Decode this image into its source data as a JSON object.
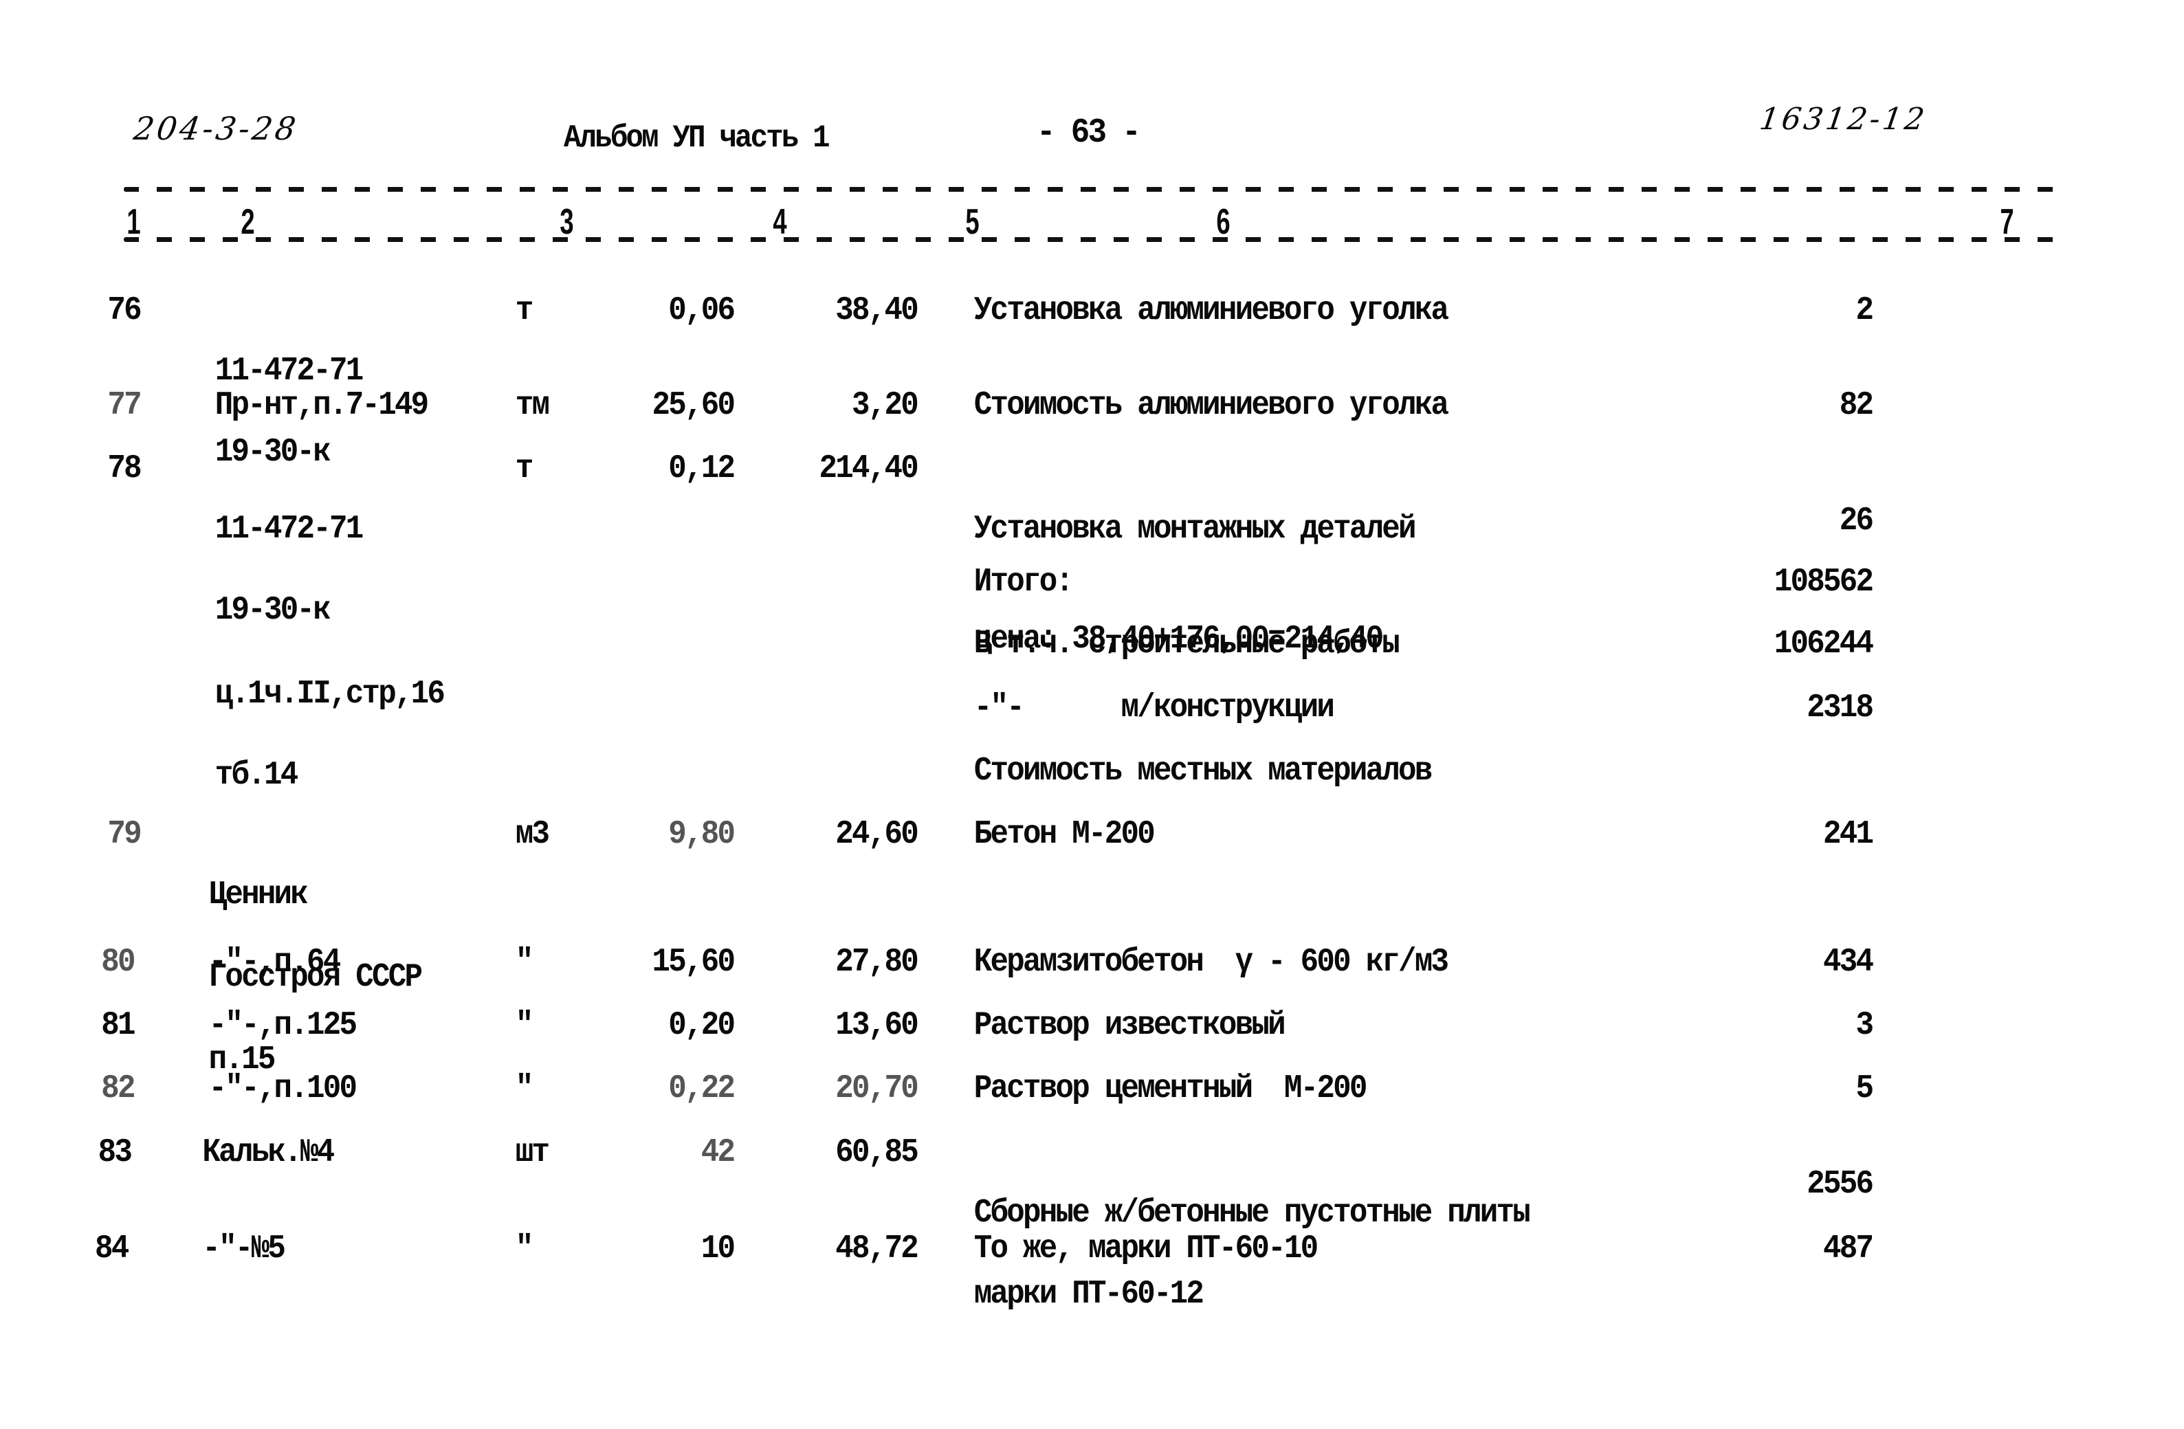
{
  "header": {
    "doc_code_handwritten": "204-3-28",
    "album_title": "Альбом УП часть 1",
    "page_number": "- 63 -",
    "archive_number_handwritten": "16312-12"
  },
  "columns": [
    "1",
    "2",
    "3",
    "4",
    "5",
    "6",
    "7"
  ],
  "rows": [
    {
      "no": "76",
      "ref": [
        "11-472-71",
        "19-30-к"
      ],
      "unit": "т",
      "quantity": "0,06",
      "price": "38,40",
      "description": [
        "Установка алюминиевого уголка"
      ],
      "cost": "2"
    },
    {
      "no": "77",
      "ref": [
        "Пр-нт,п.7-149"
      ],
      "unit": "тм",
      "quantity": "25,60",
      "price": "3,20",
      "description": [
        "Стоимость алюминиевого уголка"
      ],
      "cost": "82"
    },
    {
      "no": "78",
      "ref": [
        "11-472-71",
        "19-30-к",
        "ц.1ч.II,стр,16",
        "тб.14"
      ],
      "unit": "т",
      "quantity": "0,12",
      "price": "214,40",
      "description": [
        "Установка монтажных деталей",
        "цена: 38,40+176,00=214,40"
      ],
      "cost": "26"
    }
  ],
  "summary": [
    {
      "label": "Итого:",
      "value": "108562"
    },
    {
      "label": "В т.ч. строительные работы",
      "value": "106244"
    },
    {
      "label": "-\"-      м/конструкции",
      "value": "2318"
    },
    {
      "label": "Стоимость местных материалов",
      "value": ""
    }
  ],
  "rows_local": [
    {
      "no": "79",
      "ref": [
        "Ценник",
        "Госстроя СССР",
        "п.15"
      ],
      "unit": "м3",
      "quantity": "9,80",
      "price": "24,60",
      "description": [
        "Бетон М-200"
      ],
      "cost": "241"
    },
    {
      "no": "80",
      "ref": [
        "-\"-,п.64"
      ],
      "unit": "\"",
      "quantity": "15,60",
      "price": "27,80",
      "description": [
        "Керамзитобетон  γ - 600 кг/м3"
      ],
      "cost": "434"
    },
    {
      "no": "81",
      "ref": [
        "-\"-,п.125"
      ],
      "unit": "\"",
      "quantity": "0,20",
      "price": "13,60",
      "description": [
        "Раствор известковый"
      ],
      "cost": "3"
    },
    {
      "no": "82",
      "ref": [
        "-\"-,п.100"
      ],
      "unit": "\"",
      "quantity": "0,22",
      "price": "20,70",
      "description": [
        "Раствор цементный  М-200"
      ],
      "cost": "5"
    },
    {
      "no": "83",
      "ref": [
        "Кальк.№4"
      ],
      "unit": "шт",
      "quantity": "42",
      "price": "60,85",
      "description": [
        "Сборные ж/бетонные пустотные плиты",
        "марки ПТ-60-12"
      ],
      "cost": "2556"
    },
    {
      "no": "84",
      "ref": [
        "-\"-№5"
      ],
      "unit": "\"",
      "quantity": "10",
      "price": "48,72",
      "description": [
        "То же, марки ПТ-60-10"
      ],
      "cost": "487"
    }
  ]
}
